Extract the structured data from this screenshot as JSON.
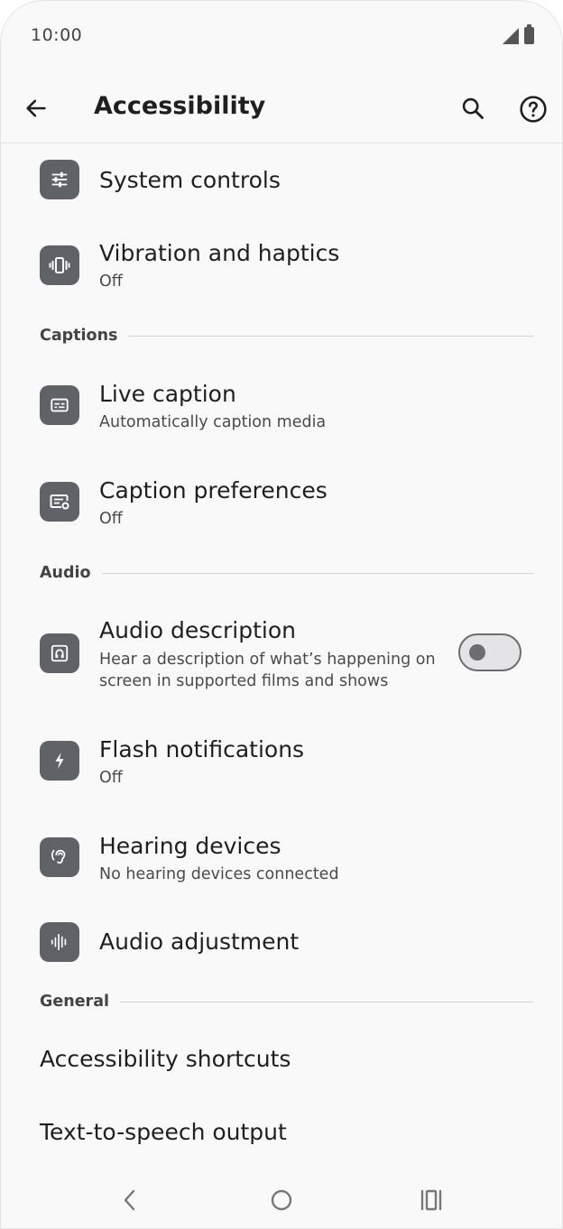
{
  "status_bar": {
    "time": "10:00"
  },
  "app_bar": {
    "title": "Accessibility"
  },
  "items": {
    "system_controls": {
      "title": "System controls"
    },
    "vibration": {
      "title": "Vibration and haptics",
      "subtitle": "Off"
    },
    "live_caption": {
      "title": "Live caption",
      "subtitle": "Automatically caption media"
    },
    "caption_prefs": {
      "title": "Caption preferences",
      "subtitle": "Off"
    },
    "audio_description": {
      "title": "Audio description",
      "subtitle_line1": "Hear a description of what’s happening on",
      "subtitle_line2": "screen in supported films and shows",
      "toggle_on": false
    },
    "flash_notifications": {
      "title": "Flash notifications",
      "subtitle": "Off"
    },
    "hearing_devices": {
      "title": "Hearing devices",
      "subtitle": "No hearing devices connected"
    },
    "audio_adjustment": {
      "title": "Audio adjustment"
    },
    "accessibility_shortcuts": {
      "title": "Accessibility shortcuts"
    },
    "tts_output": {
      "title": "Text-to-speech output"
    }
  },
  "sections": {
    "captions": "Captions",
    "audio": "Audio",
    "general": "General"
  },
  "icons": {
    "system_controls": "sliders-icon",
    "vibration": "vibration-icon",
    "live_caption": "caption-icon",
    "caption_prefs": "caption-settings-icon",
    "audio_description": "audio-description-icon",
    "flash_notifications": "flash-icon",
    "hearing_devices": "ear-icon",
    "audio_adjustment": "waveform-icon"
  },
  "colors": {
    "background": "#f9f9fa",
    "icon_tile": "#5f6368",
    "text_primary": "#1f1f1f",
    "text_secondary": "#4a4a4a",
    "divider": "#d2d2d4"
  }
}
